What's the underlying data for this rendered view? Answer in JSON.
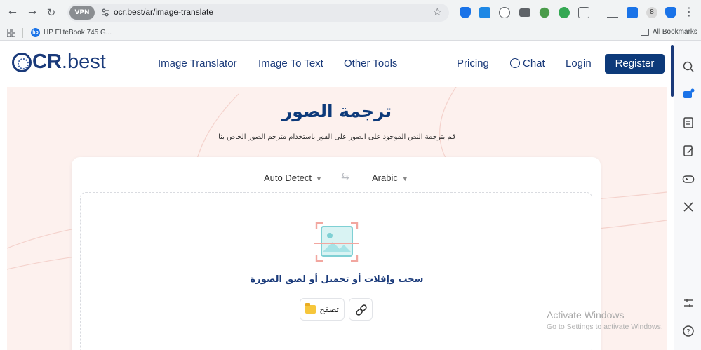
{
  "browser": {
    "vpn_label": "VPN",
    "url": "ocr.best/ar/image-translate",
    "profile_initial": "8",
    "bookmarks": [
      {
        "label": "HP EliteBook 745 G..."
      }
    ],
    "all_bookmarks_label": "All Bookmarks"
  },
  "site": {
    "logo_main": "CR",
    "logo_dot_best": ".best",
    "nav": [
      {
        "label": "Image Translator"
      },
      {
        "label": "Image To Text"
      },
      {
        "label": "Other Tools"
      },
      {
        "label": "Pricing"
      },
      {
        "label": "Chat"
      },
      {
        "label": "Login"
      }
    ],
    "register_label": "Register"
  },
  "hero": {
    "title": "ترجمة الصور",
    "subtitle": "قم بترجمة النص الموجود على الصور على الفور باستخدام مترجم الصور الخاص بنا"
  },
  "translator": {
    "source_lang": "Auto Detect",
    "target_lang": "Arabic",
    "drop_text": "سحب وإفلات أو تحميل أو لصق الصورة",
    "browse_label": "تصفح"
  },
  "os_watermark": {
    "line1": "Activate Windows",
    "line2": "Go to Settings to activate Windows."
  },
  "colors": {
    "brand": "#0d3a7a",
    "hero_bg": "#fdf1ee"
  }
}
